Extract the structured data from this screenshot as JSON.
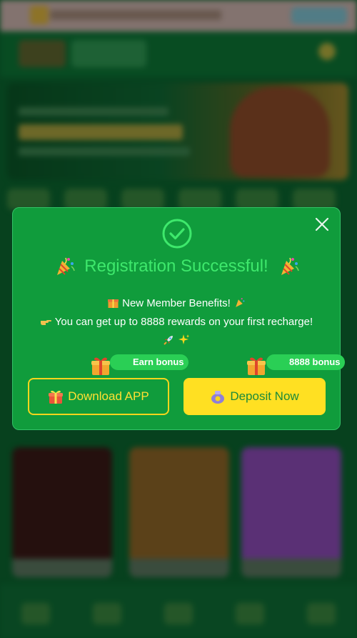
{
  "modal": {
    "title": "Registration Successful!",
    "benefit_heading": "New Member Benefits!",
    "benefit_text": "You can get up to 8888 rewards on your first recharge!",
    "badges": {
      "earn": "Earn bonus",
      "deposit": "8888 bonus"
    },
    "buttons": {
      "download": "Download APP",
      "deposit": "Deposit Now"
    }
  },
  "colors": {
    "modal_bg": "#109c3c",
    "title_green": "#3ee86c",
    "accent_yellow": "#ffe022",
    "badge_green": "#2acf55"
  },
  "icons": [
    "close-icon",
    "check-circle-icon",
    "party-popper-icon",
    "gift-icon",
    "point-right-icon",
    "rocket-icon",
    "sparkles-icon",
    "coin-bag-icon"
  ]
}
